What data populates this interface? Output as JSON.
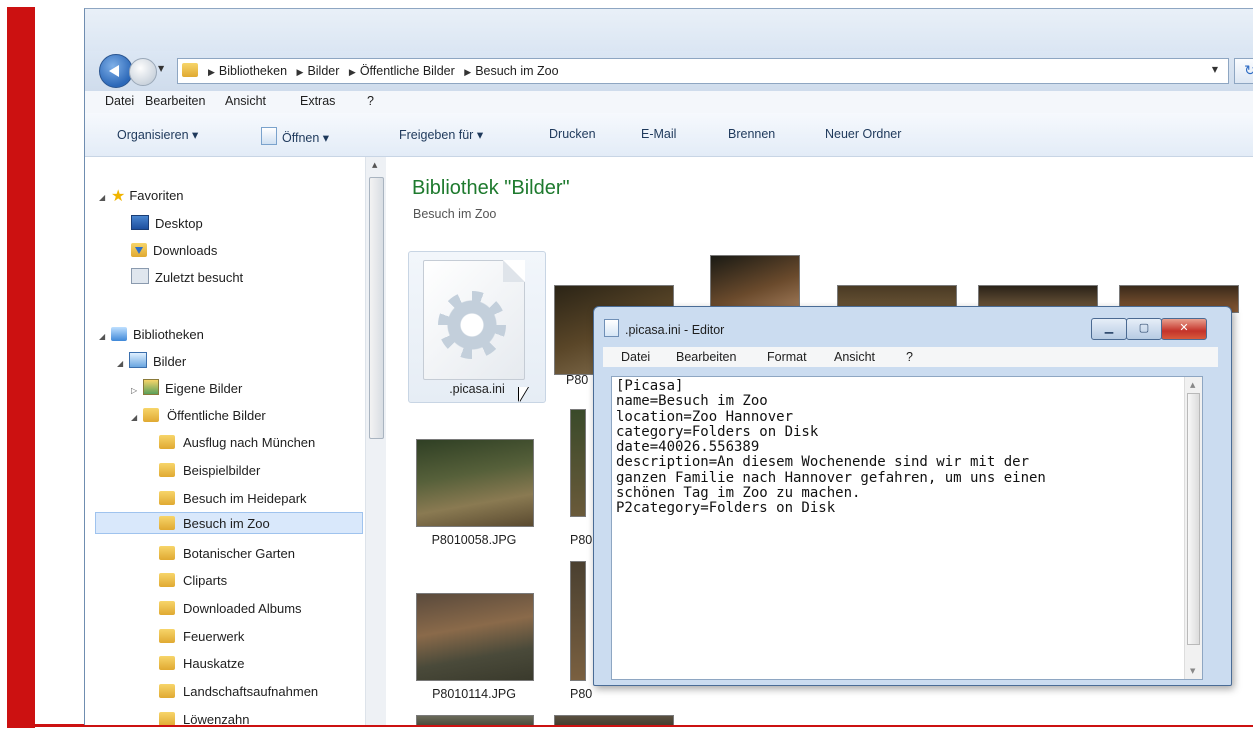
{
  "explorer": {
    "breadcrumbs": [
      "Bibliotheken",
      "Bilder",
      "Öffentliche Bilder",
      "Besuch im Zoo"
    ],
    "refresh_glyph": "↻",
    "menu": [
      "Datei",
      "Bearbeiten",
      "Ansicht",
      "Extras",
      "?"
    ],
    "commands": [
      "Organisieren ▾",
      "Öffnen ▾",
      "Freigeben für ▾",
      "Drucken",
      "E-Mail",
      "Brennen",
      "Neuer Ordner"
    ],
    "nav": {
      "favorites": "Favoriten",
      "desktop": "Desktop",
      "downloads": "Downloads",
      "recent": "Zuletzt besucht",
      "libraries": "Bibliotheken",
      "pictures": "Bilder",
      "my_pictures": "Eigene Bilder",
      "public_pictures": "Öffentliche Bilder",
      "folders": [
        "Ausflug nach München",
        "Beispielbilder",
        "Besuch im Heidepark",
        "Besuch im Zoo",
        "Botanischer Garten",
        "Cliparts",
        "Downloaded Albums",
        "Feuerwerk",
        "Hauskatze",
        "Landschaftsaufnahmen",
        "Löwenzahn"
      ],
      "selected_folder": "Besuch im Zoo"
    },
    "library_title": "Bibliothek \"Bilder\"",
    "library_subtitle": "Besuch im Zoo",
    "files": {
      "ini": ".picasa.ini",
      "f2": "P80",
      "f3": "P8010058.JPG",
      "f4": "P80",
      "f5": "P8010114.JPG",
      "f6": "P80"
    }
  },
  "editor": {
    "title": ".picasa.ini - Editor",
    "menu": [
      "Datei",
      "Bearbeiten",
      "Format",
      "Ansicht",
      "?"
    ],
    "content": "[Picasa]\nname=Besuch im Zoo\nlocation=Zoo Hannover\ncategory=Folders on Disk\ndate=40026.556389\ndescription=An diesem Wochenende sind wir mit der\nganzen Familie nach Hannover gefahren, um uns einen\nschönen Tag im Zoo zu machen.\nP2category=Folders on Disk"
  },
  "colors": {
    "frame_red": "#cc1111",
    "library_title_green": "#1e7a2e",
    "selection_blue": "#d9e8fb"
  },
  "icons": [
    "back-arrow-icon",
    "forward-arrow-icon",
    "folder-icon",
    "refresh-icon",
    "star-icon",
    "desktop-icon",
    "downloads-icon",
    "recent-places-icon",
    "library-icon",
    "pictures-library-icon",
    "gear-file-icon",
    "notepad-icon",
    "scroll-up-arrow-icon",
    "scroll-down-arrow-icon",
    "mouse-cursor"
  ]
}
